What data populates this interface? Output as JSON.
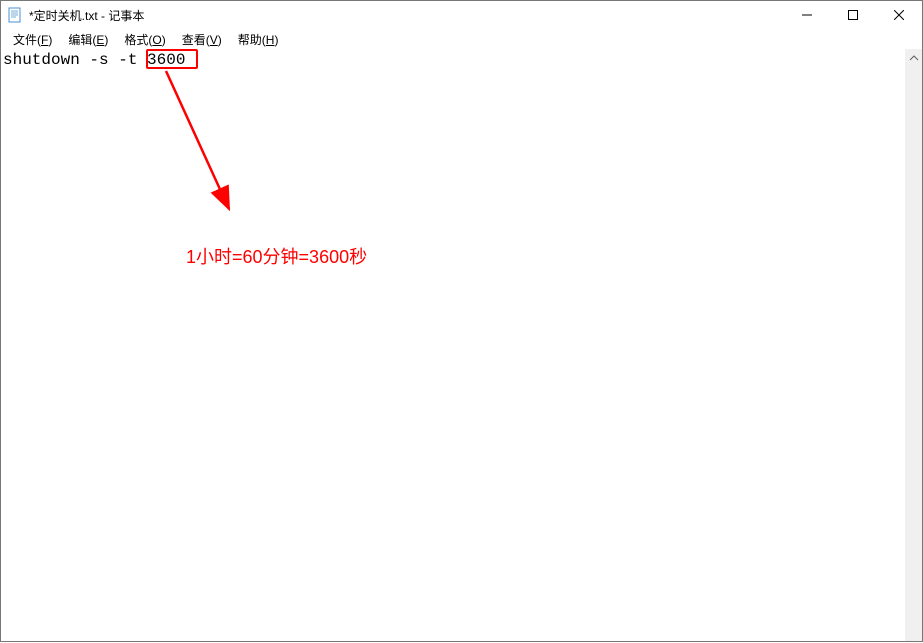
{
  "titlebar": {
    "title": "*定时关机.txt - 记事本"
  },
  "menubar": {
    "file": {
      "label": "文件",
      "hotkey": "F"
    },
    "edit": {
      "label": "编辑",
      "hotkey": "E"
    },
    "format": {
      "label": "格式",
      "hotkey": "O"
    },
    "view": {
      "label": "查看",
      "hotkey": "V"
    },
    "help": {
      "label": "帮助",
      "hotkey": "H"
    }
  },
  "editor": {
    "content_prefix": "shutdown -s -t ",
    "content_highlighted": "3600"
  },
  "annotation": {
    "text": "1小时=60分钟=3600秒"
  }
}
